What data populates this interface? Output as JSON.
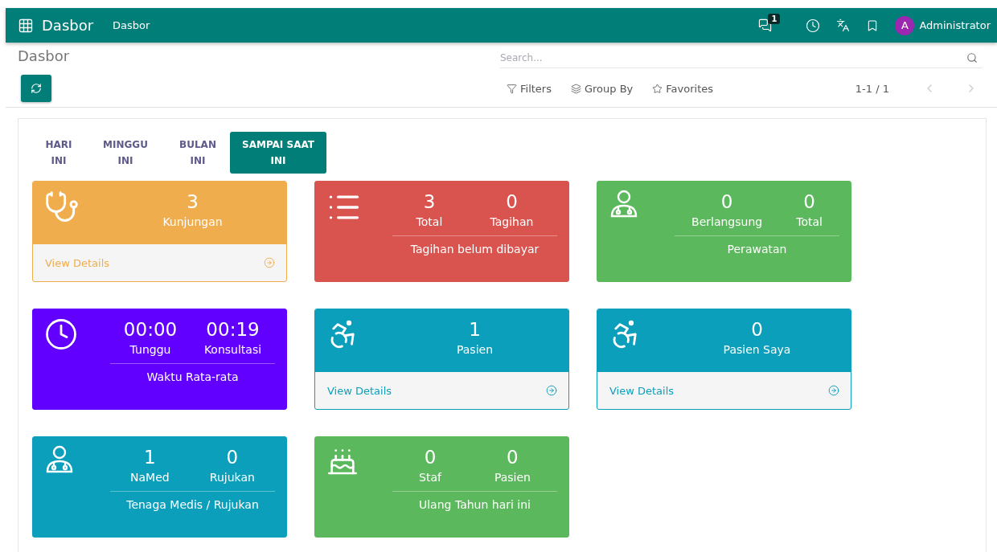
{
  "navbar": {
    "app_title": "Dasbor",
    "menu": [
      "Dasbor"
    ],
    "message_count": "1",
    "user": {
      "initial": "A",
      "name": "Administrator"
    }
  },
  "control_panel": {
    "breadcrumb": "Dasbor",
    "search": {
      "placeholder": "Search..."
    },
    "filters": [
      "Filters",
      "Group By",
      "Favorites"
    ],
    "pager": "1-1 / 1"
  },
  "tabs": [
    {
      "label": "HARI INI",
      "selected": false
    },
    {
      "label": "MINGGU INI",
      "selected": false
    },
    {
      "label": "BULAN INI",
      "selected": false
    },
    {
      "label": "SAMPAI SAAT INI",
      "selected": true
    }
  ],
  "cards": [
    {
      "kind": "details",
      "color": "#f0ad4e",
      "stats": [
        {
          "value": "3",
          "label": "Kunjungan"
        }
      ],
      "link": "View Details"
    },
    {
      "kind": "summary",
      "color": "#d9534f",
      "stats": [
        {
          "value": "3",
          "label": "Total"
        },
        {
          "value": "0",
          "label": "Tagihan"
        }
      ],
      "caption": "Tagihan belum dibayar"
    },
    {
      "kind": "summary",
      "color": "#5cb85c",
      "stats": [
        {
          "value": "0",
          "label": "Berlangsung"
        },
        {
          "value": "0",
          "label": "Total"
        }
      ],
      "caption": "Perawatan"
    },
    {
      "kind": "summary",
      "color": "#6200ff",
      "stats": [
        {
          "value": "00:00",
          "label": "Tunggu"
        },
        {
          "value": "00:19",
          "label": "Konsultasi"
        }
      ],
      "caption": "Waktu Rata-rata"
    },
    {
      "kind": "details",
      "color": "#0b9fbb",
      "stats": [
        {
          "value": "1",
          "label": "Pasien"
        }
      ],
      "link": "View Details"
    },
    {
      "kind": "details",
      "color": "#0b9fbb",
      "stats": [
        {
          "value": "0",
          "label": "Pasien Saya"
        }
      ],
      "link": "View Details"
    },
    {
      "kind": "summary",
      "color": "#0b9fbb",
      "stats": [
        {
          "value": "1",
          "label": "NaMed"
        },
        {
          "value": "0",
          "label": "Rujukan"
        }
      ],
      "caption": "Tenaga Medis / Rujukan"
    },
    {
      "kind": "summary",
      "color": "#5cb85c",
      "stats": [
        {
          "value": "0",
          "label": "Staf"
        },
        {
          "value": "0",
          "label": "Pasien"
        }
      ],
      "caption": "Ulang Tahun hari ini"
    }
  ]
}
